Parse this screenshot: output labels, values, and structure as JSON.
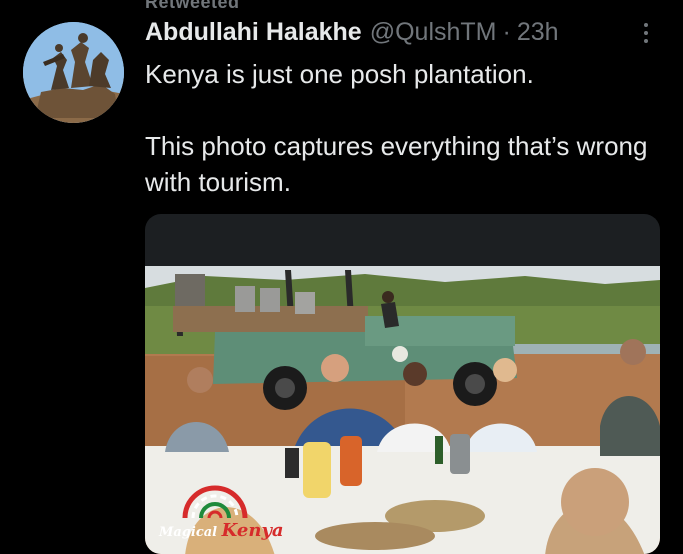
{
  "truncated_header": "Retweeted",
  "tweet": {
    "author_name": "Abdullahi Halakhe",
    "handle": "@QulshTM",
    "separator": "·",
    "time": "23h",
    "paragraphs": [
      "Kenya is just one posh plantation.",
      "This photo captures everything that’s wrong with tourism."
    ]
  },
  "media": {
    "logo_word": "Magical",
    "logo_country": "Kenya"
  },
  "icons": {
    "more": "more-vertical-icon",
    "avatar": "statue-avatar-image"
  },
  "colors": {
    "background": "#000000",
    "text": "#e7e9ea",
    "secondary": "#71767b"
  }
}
